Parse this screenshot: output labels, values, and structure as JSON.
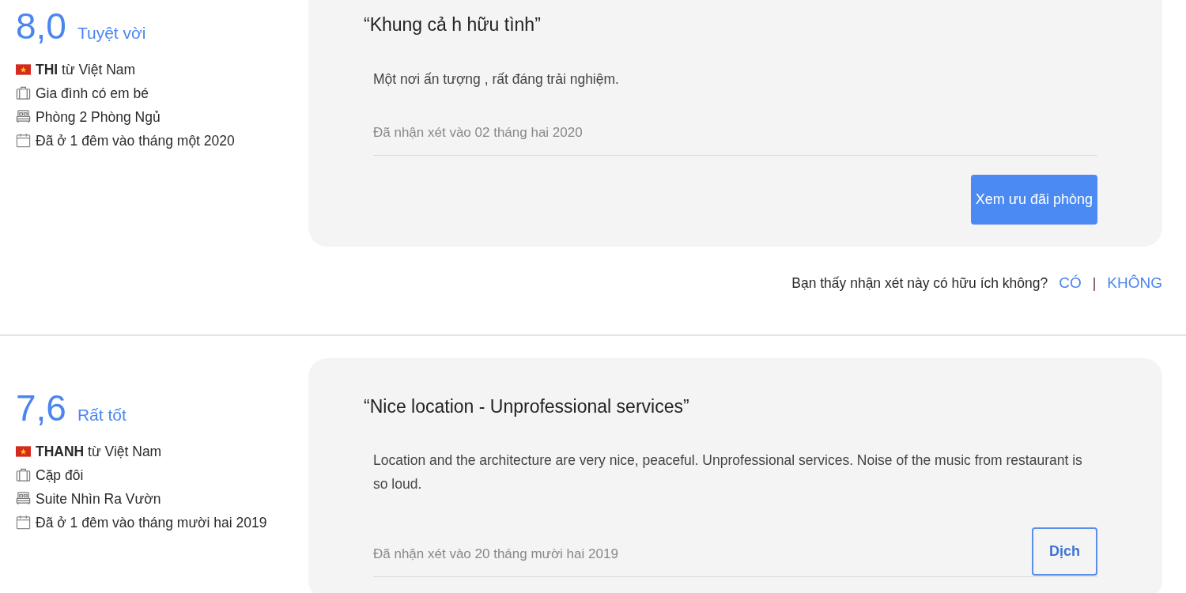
{
  "reviews": [
    {
      "score": "8,0",
      "score_label": "Tuyệt vời",
      "reviewer": "**THI** từ Việt Nam",
      "traveler_type": "Gia đình có em bé",
      "room": "Phòng 2 Phòng Ngủ",
      "stay": "Đã ở 1 đêm vào tháng một 2020",
      "title": "“Khung cả h hữu tình”",
      "text": "Một nơi ấn tượng , rất đáng trải nghiệm.",
      "review_date": "Đã nhận xét vào 02 tháng hai 2020",
      "button": {
        "label": "Xem ưu đãi phòng",
        "kind": "primary"
      },
      "helpful": {
        "question": "Bạn thấy nhận xét này có hữu ích không?",
        "yes": "CÓ",
        "separator": "|",
        "no": "KHÔNG"
      }
    },
    {
      "score": "7,6",
      "score_label": "Rất tốt",
      "reviewer": "**THANH** từ Việt Nam",
      "traveler_type": "Cặp đôi",
      "room": "Suite Nhìn Ra Vườn",
      "stay": "Đã ở 1 đêm vào tháng mười hai 2019",
      "title": "“Nice location - Unprofessional services”",
      "text": "Location and the architecture are very nice, peaceful. Unprofessional services. Noise of the music from restaurant is so loud.",
      "review_date": "Đã nhận xét vào 20 tháng mười hai 2019",
      "button": {
        "label": "Dịch",
        "kind": "outline"
      }
    }
  ]
}
